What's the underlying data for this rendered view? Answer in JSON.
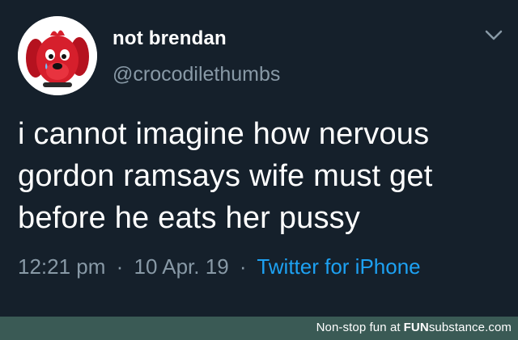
{
  "tweet": {
    "display_name": "not brendan",
    "handle": "@crocodilethumbs",
    "text_lines": [
      "i cannot imagine how nervous",
      "gordon ramsays wife must get",
      "before he eats her pussy"
    ],
    "time": "12:21 pm",
    "separator": "·",
    "date": "10 Apr. 19",
    "source": "Twitter for iPhone",
    "avatar_icon": "clifford-dog-avatar-icon",
    "menu_icon": "chevron-down-icon"
  },
  "footer": {
    "prefix": "Non-stop fun at",
    "brand_bold": "FUN",
    "brand_rest": "substance",
    "brand_suffix": ".com"
  },
  "colors": {
    "background": "#15202b",
    "secondary_text": "#8899a6",
    "link": "#1da1f2",
    "footer_bar": "#3a5a55",
    "avatar_dog": "#d61f2c"
  }
}
